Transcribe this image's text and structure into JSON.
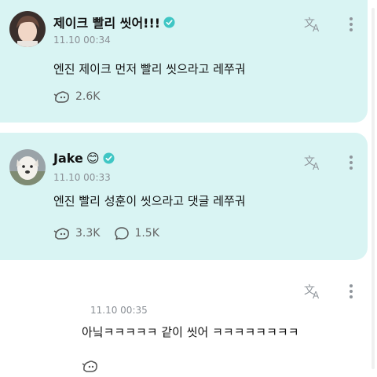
{
  "posts": [
    {
      "name": "제이크 빨리 씻어!!!",
      "timestamp": "11.10 00:34",
      "body": "엔진 제이크 먼저 빨리 씻으라고 레쭈궈",
      "reactions": "2.6K",
      "verified_color": "#3fc6c4"
    },
    {
      "name": "Jake",
      "name_emoji": "😊",
      "timestamp": "11.10 00:33",
      "body": "엔진 빨리 성훈이 씻으라고 댓글 레쭈궈",
      "reactions": "3.3K",
      "comments": "1.5K",
      "verified_color": "#3fc6c4"
    },
    {
      "timestamp": "11.10 00:35",
      "body": "아닠ㅋㅋㅋㅋㅋ 같이 씻어 ㅋㅋㅋㅋㅋㅋㅋㅋ"
    }
  ],
  "colors": {
    "card_bg": "#d9f4f3",
    "accent": "#3fc6c4",
    "muted_text": "#8a8f95"
  },
  "icons": [
    "verified-badge-icon",
    "translate-icon",
    "more-options-icon",
    "reaction-icon",
    "comment-icon"
  ]
}
